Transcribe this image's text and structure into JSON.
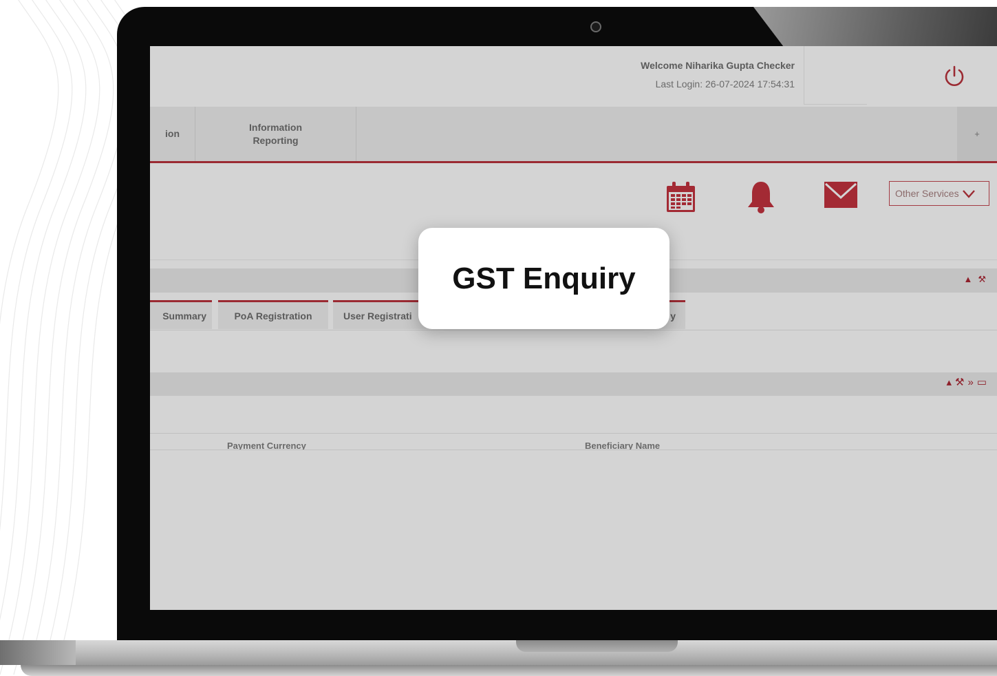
{
  "header": {
    "welcome": "Welcome Niharika Gupta Checker",
    "last_login": "Last Login: 26-07-2024 17:54:31"
  },
  "nav": {
    "items": [
      {
        "label": "ion"
      },
      {
        "label": "Information Reporting"
      }
    ],
    "more_label": "+"
  },
  "toolbar": {
    "icons": [
      "calendar-icon",
      "bell-icon",
      "mail-icon"
    ],
    "other_services_label": "Other Services"
  },
  "tabs": [
    {
      "label": "Summary"
    },
    {
      "label": "PoA Registration"
    },
    {
      "label": "User Registrati"
    },
    {
      "label": "y"
    }
  ],
  "table": {
    "columns": [
      "Payment Currency",
      "Beneficiary Name"
    ]
  },
  "popup": {
    "title": "GST Enquiry"
  },
  "colors": {
    "accent": "#9b2a32",
    "screen_bg": "#d4d4d4"
  }
}
